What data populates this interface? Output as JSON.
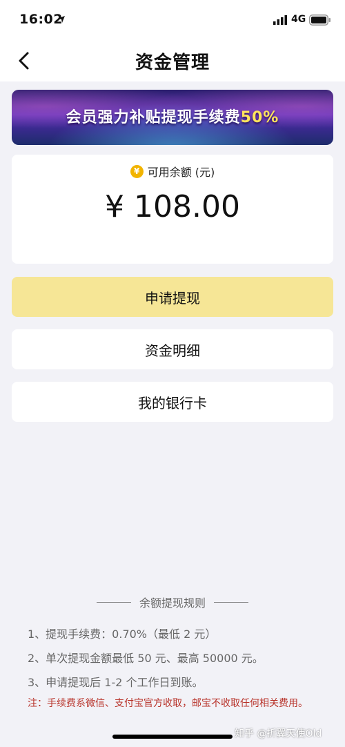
{
  "status_bar": {
    "time": "16:02",
    "network": "4G",
    "icons": [
      "location-arrow-icon",
      "signal-icon",
      "battery-icon"
    ]
  },
  "nav": {
    "title": "资金管理",
    "back_icon": "chevron-left-icon"
  },
  "banner": {
    "text": "会员强力补贴提现手续费",
    "highlight": "50%"
  },
  "balance": {
    "label": "可用余额 (元)",
    "coin_symbol": "¥",
    "amount": "¥ 108.00"
  },
  "actions": {
    "withdraw": "申请提现",
    "detail": "资金明细",
    "bank_card": "我的银行卡"
  },
  "rules": {
    "title": "余额提现规则",
    "items": [
      "1、提现手续费：0.70%（最低 2 元）",
      "2、单次提现金额最低 50 元、最高 50000 元。",
      "3、申请提现后 1-2 个工作日到账。"
    ],
    "note": "注：手续费系微信、支付宝官方收取，邮宝不收取任何相关费用。"
  },
  "watermark": "知乎 @折翼天使Old",
  "colors": {
    "withdraw_button": "#f6e696",
    "note_text": "#b8332a",
    "coin": "#f2b400"
  }
}
